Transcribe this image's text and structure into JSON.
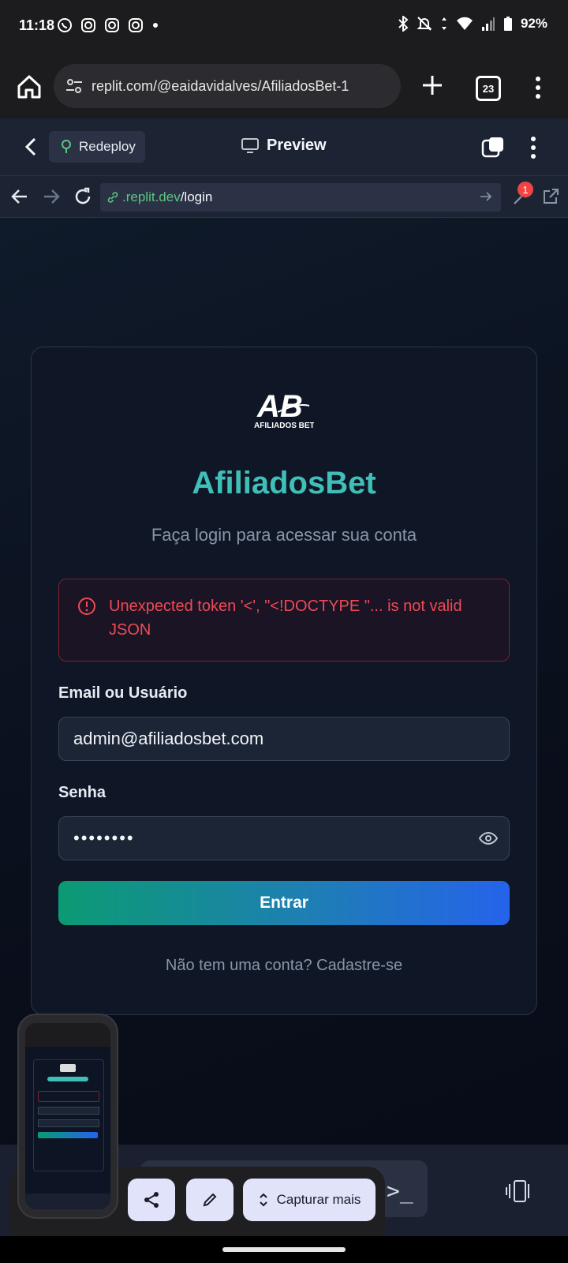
{
  "status_bar": {
    "time": "11:18",
    "battery": "92%"
  },
  "browser": {
    "url": "replit.com/@eaidavidalves/AfiliadosBet-1",
    "tab_count": "23"
  },
  "replit": {
    "redeploy_label": "Redeploy",
    "preview_label": "Preview"
  },
  "webview": {
    "url_domain": ".replit.dev",
    "url_path": "/login",
    "devtools_badge": "1"
  },
  "login": {
    "logo_text": "AFILIADOS BET",
    "logo_letters": "AB",
    "brand": "AfiliadosBet",
    "subtitle": "Faça login para acessar sua conta",
    "error_message": "Unexpected token '<', \"<!DOCTYPE \"... is not valid JSON",
    "email_label": "Email ou Usuário",
    "email_value": "admin@afiliadosbet.com",
    "password_label": "Senha",
    "password_value": "••••••••",
    "submit_label": "Entrar",
    "signup_text": "Não tem uma conta? Cadastre-se"
  },
  "screenshot_toolbar": {
    "capture_more_label": "Capturar mais"
  },
  "colors": {
    "brand_teal": "#3fbfb7",
    "error_red": "#ef4a55",
    "button_gradient_start": "#0b9b73",
    "button_gradient_end": "#2563eb"
  }
}
